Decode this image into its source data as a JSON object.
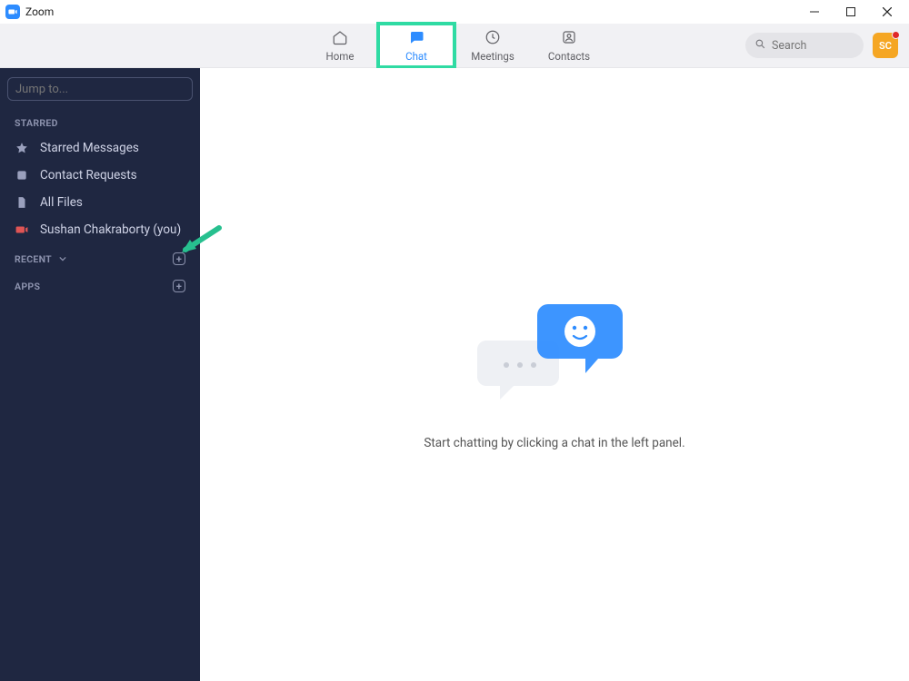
{
  "window": {
    "title": "Zoom"
  },
  "nav": {
    "tabs": [
      {
        "label": "Home"
      },
      {
        "label": "Chat"
      },
      {
        "label": "Meetings"
      },
      {
        "label": "Contacts"
      }
    ],
    "active_tab_index": 1,
    "highlighted_tab_index": 1
  },
  "search": {
    "placeholder": "Search"
  },
  "avatar": {
    "initials": "SC",
    "has_notification": true
  },
  "sidebar": {
    "jump_placeholder": "Jump to...",
    "starred_label": "STARRED",
    "starred_items": [
      {
        "label": "Starred Messages",
        "icon": "star"
      },
      {
        "label": "Contact Requests",
        "icon": "contact"
      },
      {
        "label": "All Files",
        "icon": "file"
      },
      {
        "label": "Sushan Chakraborty (you)",
        "icon": "camera"
      }
    ],
    "recent_label": "RECENT",
    "apps_label": "APPS"
  },
  "main": {
    "empty_text": "Start chatting by clicking a chat in the left panel."
  },
  "colors": {
    "accent": "#2D8CFF",
    "highlight": "#2fdba3",
    "sidebar_bg": "#1f2741"
  }
}
